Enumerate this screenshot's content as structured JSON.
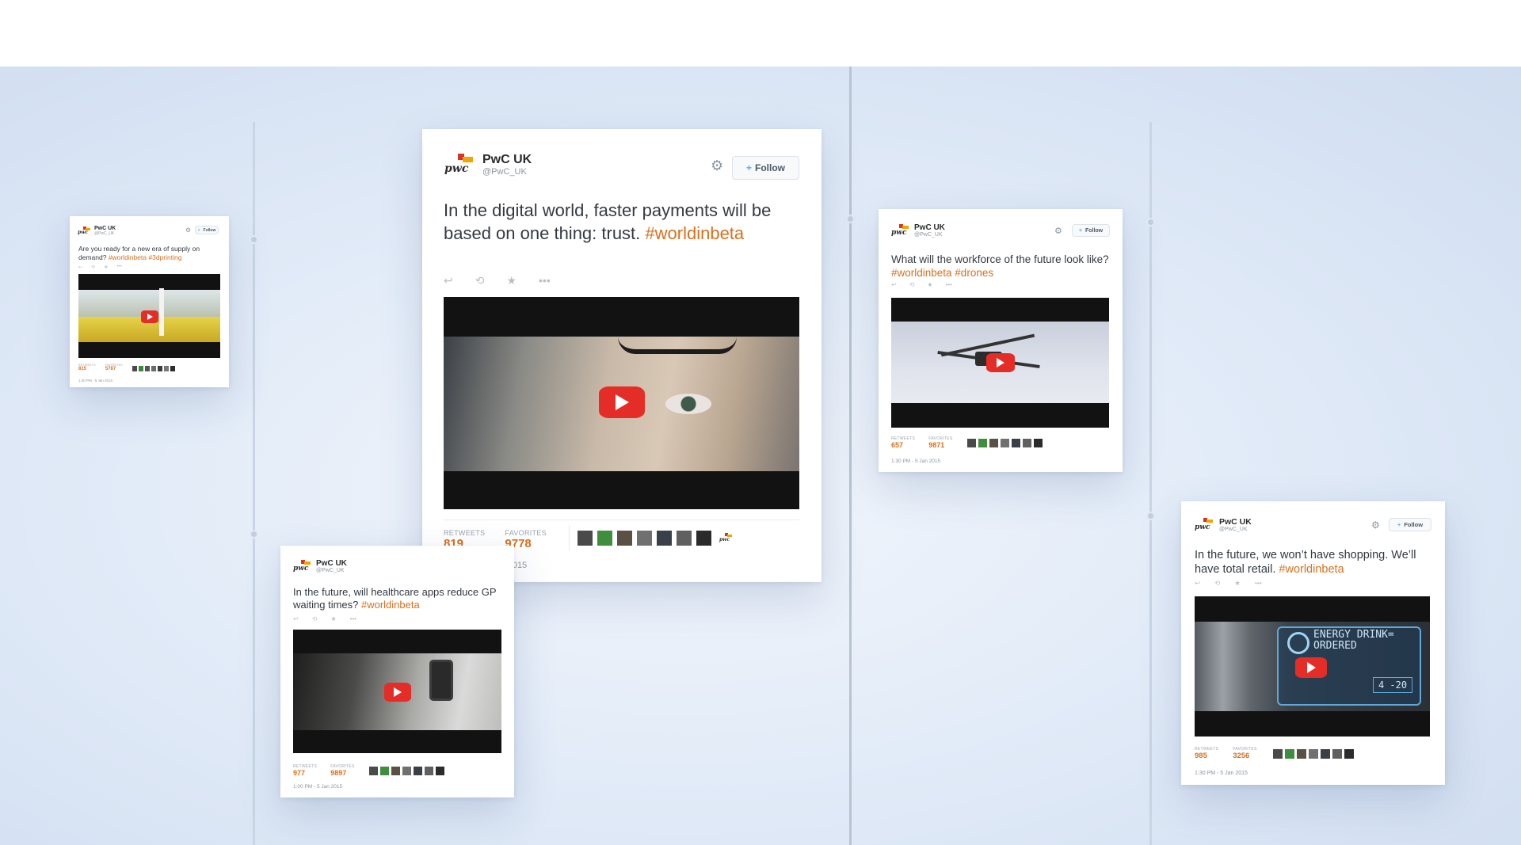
{
  "colors": {
    "hashtag": "#d8701e",
    "play": "#e52d27",
    "accent": "#55acee"
  },
  "tweets": [
    {
      "id": "featured",
      "name": "PwC UK",
      "handle": "@PwC_UK",
      "logo_text": "pwc",
      "follow": "Follow",
      "text": "In the digital world, faster payments will be based on one thing: trust. ",
      "hashtags": "#worldinbeta",
      "retweets_label": "RETWEETS",
      "retweets": "819",
      "favorites_label": "FAVORITES",
      "favorites": "9778",
      "time": "1:30 PM - 5 Jan 2015"
    },
    {
      "id": "printing",
      "name": "PwC UK",
      "handle": "@PwC_UK",
      "logo_text": "pwc",
      "follow": "Follow",
      "text": "Are you ready for a new era of supply on demand? ",
      "hashtags": "#worldinbeta #3dprinting",
      "retweets_label": "RETWEETS",
      "retweets": "815",
      "favorites_label": "FAVORITES",
      "favorites": "5787",
      "time": "1:30 PM - 5 Jan 2015"
    },
    {
      "id": "healthcare",
      "name": "PwC UK",
      "handle": "@PwC_UK",
      "logo_text": "pwc",
      "text": "In the future, will healthcare apps reduce GP waiting times? ",
      "hashtags": "#worldinbeta",
      "retweets_label": "RETWEETS",
      "retweets": "977",
      "favorites_label": "FAVORITES",
      "favorites": "9897",
      "time": "1:00 PM - 5 Jan 2015"
    },
    {
      "id": "drones",
      "name": "PwC UK",
      "handle": "@PwC_UK",
      "logo_text": "pwc",
      "follow": "Follow",
      "text": "What will the workforce of the future look like? ",
      "hashtags": "#worldinbeta #drones",
      "retweets_label": "RETWEETS",
      "retweets": "657",
      "favorites_label": "FAVORITES",
      "favorites": "9871",
      "time": "1:30 PM - 5 Jan 2015"
    },
    {
      "id": "retail",
      "name": "PwC UK",
      "handle": "@PwC_UK",
      "logo_text": "pwc",
      "follow": "Follow",
      "text": "In the future, we won’t have shopping. We’ll have total retail. ",
      "hashtags": "#worldinbeta",
      "retweets_label": "RETWEETS",
      "retweets": "985",
      "favorites_label": "FAVORITES",
      "favorites": "3256",
      "time": "1:30 PM - 5 Jan 2015",
      "video_overlay_line1": "ENERGY DRINK=",
      "video_overlay_line2": "ORDERED",
      "video_readout": "4  -20"
    }
  ],
  "icons": {
    "gear": "gear-icon",
    "follow_person": "add-person-icon",
    "reply": "reply-icon",
    "retweet": "retweet-icon",
    "favorite": "star-icon",
    "more": "more-icon",
    "play": "play-icon"
  }
}
